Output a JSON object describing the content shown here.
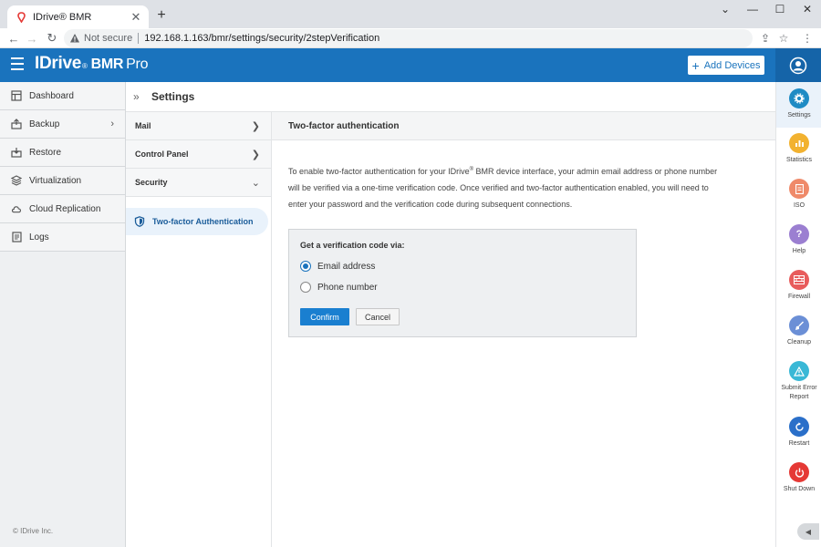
{
  "browser": {
    "tab_title": "IDrive® BMR",
    "security_label": "Not secure",
    "url": "192.168.1.163/bmr/settings/security/2stepVerification"
  },
  "header": {
    "logo_main": "IDrive",
    "logo_reg": "®",
    "logo_bmr": "BMR",
    "logo_pro": "Pro",
    "add_devices_plus": "+",
    "add_devices_label": "Add Devices"
  },
  "sidebar": {
    "items": [
      {
        "label": "Dashboard",
        "icon": "dashboard-icon"
      },
      {
        "label": "Backup",
        "icon": "backup-icon"
      },
      {
        "label": "Restore",
        "icon": "restore-icon"
      },
      {
        "label": "Virtualization",
        "icon": "virtualization-icon"
      },
      {
        "label": "Cloud Replication",
        "icon": "cloud-icon"
      },
      {
        "label": "Logs",
        "icon": "logs-icon"
      }
    ],
    "copyright": "© IDrive Inc."
  },
  "settings": {
    "title": "Settings",
    "sub_nav": [
      "Mail",
      "Control Panel",
      "Security"
    ],
    "active_child": "Two-factor Authentication"
  },
  "content": {
    "heading": "Two-factor authentication",
    "desc_part1": "To enable two-factor authentication for your IDrive",
    "desc_reg": "®",
    "desc_part2": " BMR device interface, your admin email address or phone number will be verified via a one-time verification code. Once verified and two-factor authentication enabled, you will need to enter your password and the verification code during subsequent connections.",
    "verify_title": "Get a verification code via:",
    "option_email": "Email address",
    "option_phone": "Phone number",
    "selected_option": "email",
    "confirm_label": "Confirm",
    "cancel_label": "Cancel"
  },
  "rail": {
    "items": [
      {
        "label": "Settings",
        "color": "#1f8bc4"
      },
      {
        "label": "Statistics",
        "color": "#f2b230"
      },
      {
        "label": "ISO",
        "color": "#ef8a6a"
      },
      {
        "label": "Help",
        "color": "#9b7fd1"
      },
      {
        "label": "Firewall",
        "color": "#e85c5c"
      },
      {
        "label": "Cleanup",
        "color": "#6b8fd6"
      },
      {
        "label": "Submit Error Report",
        "color": "#39b8d6"
      },
      {
        "label": "Restart",
        "color": "#2a6fc9"
      },
      {
        "label": "Shut Down",
        "color": "#e53935"
      }
    ]
  }
}
